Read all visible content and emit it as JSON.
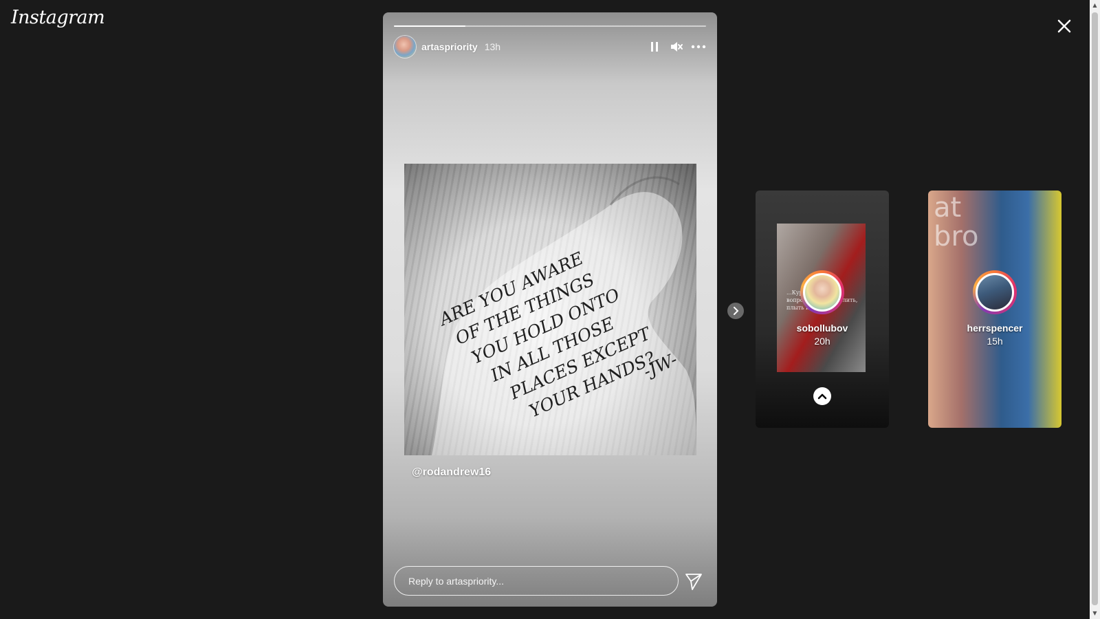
{
  "brand": {
    "logo_text": "Instagram"
  },
  "story": {
    "username": "artaspriority",
    "time_ago": "13h",
    "progress_fraction": 0.23,
    "image_text": [
      "ARE YOU AWARE",
      "OF THE THINGS",
      "YOU HOLD ONTO",
      "IN ALL THOSE",
      "PLACES EXCEPT",
      "YOUR HANDS?",
      "-JW-"
    ],
    "mention": "@rodandrew16",
    "reply_placeholder": "Reply to artaspriority..."
  },
  "controls": {
    "pause_icon": "pause-icon",
    "mute_icon": "speaker-muted-icon",
    "more_icon": "more-horizontal-icon",
    "send_icon": "send-icon",
    "close_icon": "close-icon",
    "next_icon": "chevron-right-icon"
  },
  "previews": [
    {
      "username": "sobollubov",
      "time_ago": "20h",
      "thumb_text": "...Курс... Путин... вопрос... начал... юлить, плыть и не..."
    },
    {
      "username": "herrspencer",
      "time_ago": "15h",
      "thumb_text": "at bro"
    }
  ],
  "colors": {
    "background": "#1a1a1a",
    "story_ring": [
      "#f77737",
      "#e1306c",
      "#c13584",
      "#833ab4",
      "#fcaf45"
    ]
  }
}
